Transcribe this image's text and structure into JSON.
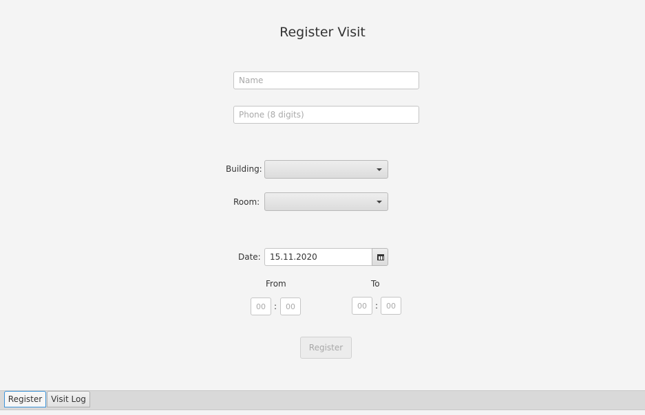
{
  "form": {
    "title": "Register Visit",
    "name_placeholder": "Name",
    "phone_placeholder": "Phone (8 digits)",
    "building_label": "Building:",
    "room_label": "Room:",
    "date_label": "Date:",
    "date_value": "15.11.2020",
    "from_label": "From",
    "to_label": "To",
    "time_placeholder": "00",
    "colon": ":",
    "register_label": "Register"
  },
  "tabs": [
    {
      "label": "Register",
      "active": true
    },
    {
      "label": "Visit Log",
      "active": false
    }
  ],
  "icons": {
    "combo_arrow": "chevron-down-icon",
    "date_picker": "calendar-icon"
  },
  "colors": {
    "background": "#f4f4f4",
    "active_tab_border": "#3c93d8"
  }
}
